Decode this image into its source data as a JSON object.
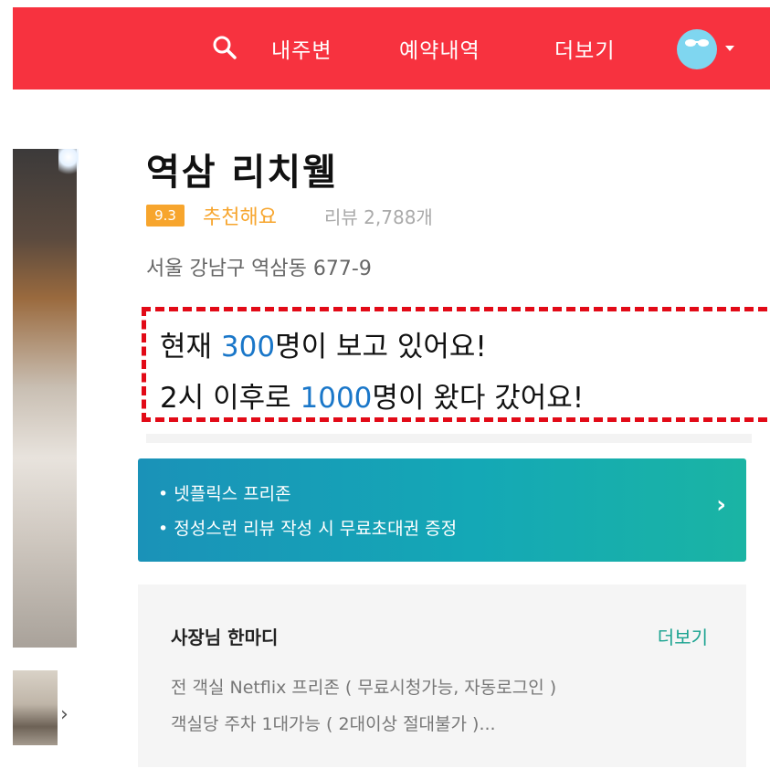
{
  "header": {
    "nav": [
      "내주변",
      "예약내역",
      "더보기"
    ],
    "bg_color": "#f7323f",
    "search_icon": "search-icon",
    "avatar_icon": "avatar-sunglasses-icon"
  },
  "hotel": {
    "name": "역삼 리치웰",
    "score": "9.3",
    "recommend": "추천해요",
    "review_label": "리뷰",
    "review_count": "2,788개",
    "address": "서울 강남구 역삼동 677-9"
  },
  "notice": {
    "line1": {
      "pre": "현재 ",
      "num": "300",
      "post": "명이 보고 있어요!"
    },
    "line2": {
      "pre": "2시 이후로 ",
      "num": "1000",
      "post": "명이 왔다 갔어요!"
    },
    "border_color": "#e20a17",
    "number_color": "#1a77c9"
  },
  "promo": {
    "items": [
      "• 넷플릭스 프리존",
      "• 정성스런 리뷰 작성 시 무료초대권 증정"
    ],
    "arrow_icon": "chevron-right-icon"
  },
  "owner": {
    "title": "사장님 한마디",
    "more": "더보기",
    "lines": [
      "전 객실 Netflix 프리존 ( 무료시청가능, 자동로그인 )",
      "객실당 주차 1대가능 ( 2대이상 절대불가 )..."
    ]
  }
}
